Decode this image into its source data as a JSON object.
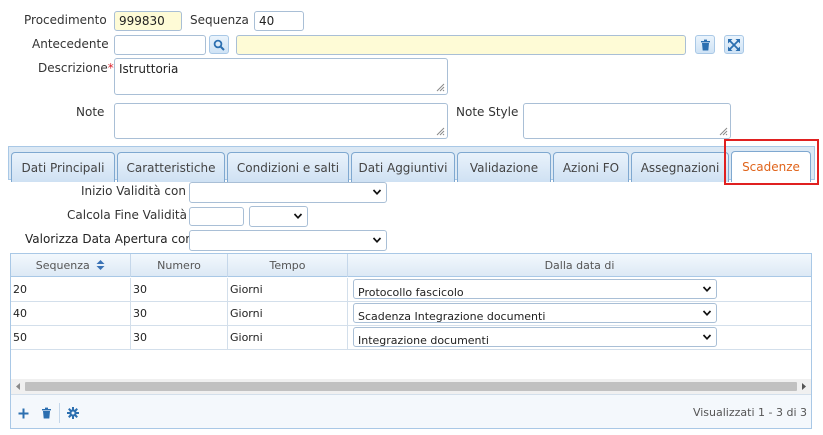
{
  "form": {
    "procedimento_label": "Procedimento",
    "procedimento_value": "999830",
    "sequenza_label": "Sequenza",
    "sequenza_value": "40",
    "antecedente_label": "Antecedente",
    "antecedente_code": "",
    "antecedente_desc": "",
    "descrizione_label": "Descrizione",
    "required_mark": "*",
    "descrizione_value": "Istruttoria",
    "note_label": "Note",
    "note_value": "",
    "note_style_label": "Note Style",
    "note_style_value": ""
  },
  "tabs": [
    {
      "label": "Dati Principali"
    },
    {
      "label": "Caratteristiche"
    },
    {
      "label": "Condizioni e salti"
    },
    {
      "label": "Dati Aggiuntivi"
    },
    {
      "label": "Validazione"
    },
    {
      "label": "Azioni FO"
    },
    {
      "label": "Assegnazioni"
    },
    {
      "label": "Scadenze",
      "active": true
    }
  ],
  "scadenze": {
    "inizio_validita_label": "Inizio Validità con",
    "inizio_validita_value": "",
    "calcola_fine_label": "Calcola Fine Validità",
    "calcola_fine_value": "",
    "calcola_fine_unit": "",
    "valorizza_label": "Valorizza Data Apertura con",
    "valorizza_value": ""
  },
  "grid": {
    "columns": [
      "Sequenza",
      "Numero",
      "Tempo",
      "Dalla data di"
    ],
    "rows": [
      [
        "20",
        "30",
        "Giorni",
        "Protocollo fascicolo"
      ],
      [
        "40",
        "30",
        "Giorni",
        "Scadenza Integrazione documenti"
      ],
      [
        "50",
        "30",
        "Giorni",
        "Integrazione documenti"
      ]
    ],
    "pager_text": "Visualizzati 1 - 3 di 3"
  },
  "icons": {
    "search": "search-icon",
    "delete": "trash-icon",
    "expand": "expand-icon",
    "add": "plus-icon",
    "settings": "gear-icon",
    "sort": "sort-icon"
  },
  "colors": {
    "active_tab_text": "#e0641b",
    "highlight_box": "#e02020",
    "required_mark": "#d9232e",
    "yellow_field": "#fefbd6"
  }
}
